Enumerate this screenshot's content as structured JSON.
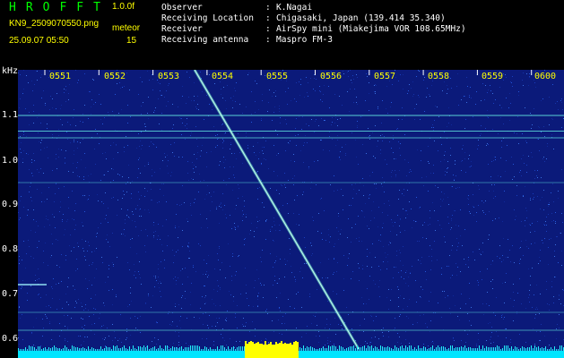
{
  "header": {
    "app_title": "HROFFT",
    "version": "1.0.0f",
    "filename": "KN9_2509070550.png",
    "mode": "meteor",
    "timestamp": "25.09.07 05:50",
    "count": "15",
    "metadata": [
      {
        "label": "Observer",
        "value": "K.Nagai"
      },
      {
        "label": "Receiving Location",
        "value": "Chigasaki, Japan (139.414 35.340)"
      },
      {
        "label": "Receiver",
        "value": "AirSpy mini (Miakejima VOR 108.65MHz)"
      },
      {
        "label": "Receiving antenna",
        "value": "Maspro FM-3"
      }
    ]
  },
  "axes": {
    "y_unit": "kHz",
    "y_ticks": [
      "1.1",
      "1.0",
      "0.9",
      "0.8",
      "0.7",
      "0.6"
    ],
    "x_ticks": [
      "0551",
      "0552",
      "0553",
      "0554",
      "0555",
      "0556",
      "0557",
      "0558",
      "0559",
      "0600"
    ]
  },
  "colors": {
    "background": "#000000",
    "spectrogram_base": "#0b1a7a",
    "trace": "#7ff6d6",
    "title_green": "#00ff00",
    "label_yellow": "#ffff00",
    "signal_cyan": "#00e5ff"
  }
}
